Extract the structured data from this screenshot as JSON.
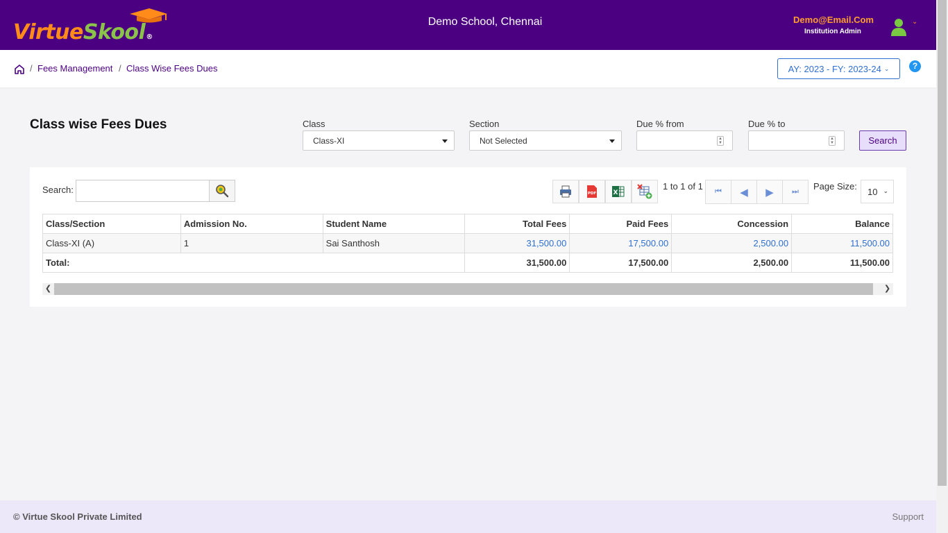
{
  "app": {
    "logo_part1": "Virtue",
    "logo_part2": "Skool",
    "logo_reg": "®",
    "school_name": "Demo School, Chennai",
    "user_email": "Demo@Email.Com",
    "user_role": "Institution Admin"
  },
  "breadcrumb": {
    "items": [
      "Fees Management",
      "Class Wise Fees Dues"
    ],
    "separator": "/"
  },
  "ay_selector": {
    "label": "AY: 2023 - FY: 2023-24"
  },
  "help": {
    "label": "?"
  },
  "page": {
    "title": "Class wise Fees Dues"
  },
  "filters": {
    "class_label": "Class",
    "class_value": "Class-XI",
    "section_label": "Section",
    "section_value": "Not Selected",
    "due_from_label": "Due % from",
    "due_to_label": "Due % to",
    "search_button": "Search"
  },
  "grid_toolbar": {
    "search_label": "Search:",
    "pager_text": "1 to 1 of 1",
    "page_size_label": "Page Size:",
    "page_size_value": "10"
  },
  "table": {
    "columns": [
      "Class/Section",
      "Admission No.",
      "Student Name",
      "Total Fees",
      "Paid Fees",
      "Concession",
      "Balance"
    ],
    "rows": [
      [
        "Class-XI (A)",
        "1",
        "Sai Santhosh",
        "31,500.00",
        "17,500.00",
        "2,500.00",
        "11,500.00"
      ]
    ],
    "total": {
      "label": "Total:",
      "total_fees": "31,500.00",
      "paid_fees": "17,500.00",
      "concession": "2,500.00",
      "balance": "11,500.00"
    }
  },
  "footer": {
    "copyright": "© Virtue Skool Private Limited",
    "support": "Support"
  },
  "colors": {
    "header_bg": "#4b0082",
    "accent_orange": "#ff8c1a",
    "accent_green": "#8bc34a",
    "link_blue": "#2f6fd0",
    "footer_bg": "#ece8fa"
  }
}
